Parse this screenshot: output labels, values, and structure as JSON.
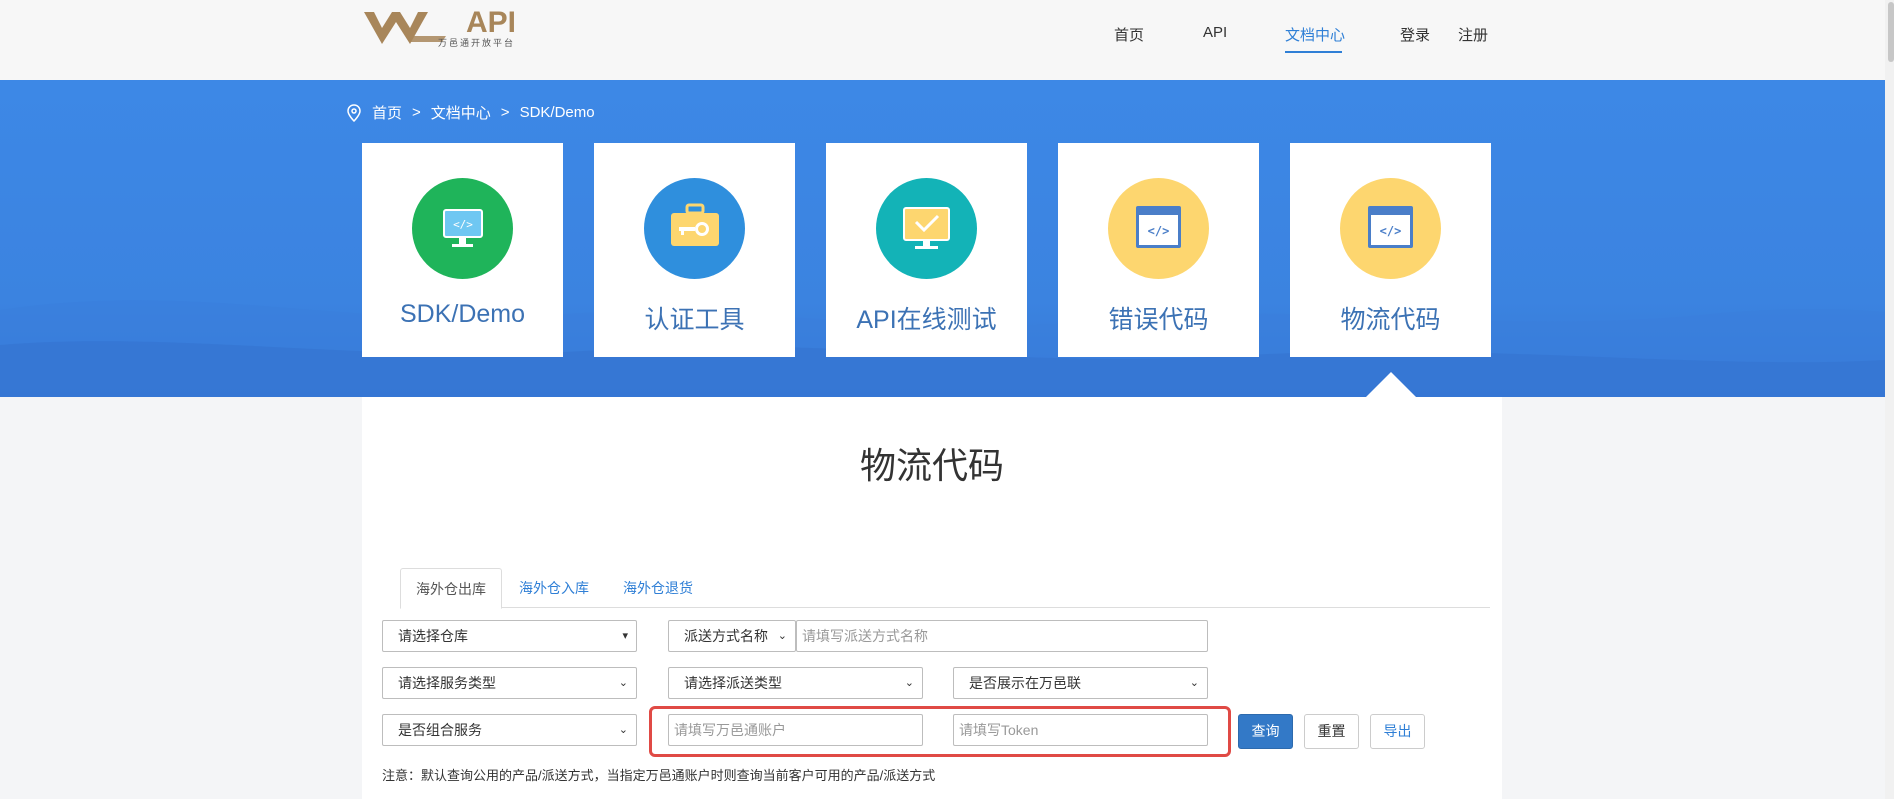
{
  "header": {
    "logo_text": "API",
    "logo_sub": "万邑通开放平台",
    "nav": [
      {
        "label": "首页"
      },
      {
        "label": "API"
      },
      {
        "label": "文档中心"
      },
      {
        "label": "登录"
      },
      {
        "label": "注册"
      }
    ]
  },
  "breadcrumb": {
    "items": [
      "首页",
      "文档中心",
      "SDK/Demo"
    ],
    "separator": ">"
  },
  "cards": [
    {
      "label": "SDK/Demo",
      "icon": "monitor-code-icon",
      "color": "#1fb45a"
    },
    {
      "label": "认证工具",
      "icon": "key-case-icon",
      "color": "#2f8fdd"
    },
    {
      "label": "API在线测试",
      "icon": "monitor-check-icon",
      "color": "#13b3b7"
    },
    {
      "label": "错误代码",
      "icon": "code-window-icon",
      "color": "#fdd66f"
    },
    {
      "label": "物流代码",
      "icon": "code-window-icon",
      "color": "#fdd66f"
    }
  ],
  "main": {
    "title": "物流代码",
    "tabs": [
      {
        "label": "海外仓出库"
      },
      {
        "label": "海外仓入库"
      },
      {
        "label": "海外仓退货"
      }
    ],
    "filters": {
      "warehouse_select": "请选择仓库",
      "delivery_name_select": "派送方式名称",
      "delivery_name_placeholder": "请填写派送方式名称",
      "service_type_select": "请选择服务类型",
      "delivery_type_select": "请选择派送类型",
      "show_in_wyl_select": "是否展示在万邑联",
      "combo_service_select": "是否组合服务",
      "account_placeholder": "请填写万邑通账户",
      "token_placeholder": "请填写Token"
    },
    "buttons": {
      "query": "查询",
      "reset": "重置",
      "export": "导出"
    },
    "note": "注意：默认查询公用的产品/派送方式，当指定万邑通账户时则查询当前客户可用的产品/派送方式"
  },
  "colors": {
    "accent": "#2f7fd6",
    "banner": "#3d88e6",
    "highlight": "#e04a45"
  }
}
